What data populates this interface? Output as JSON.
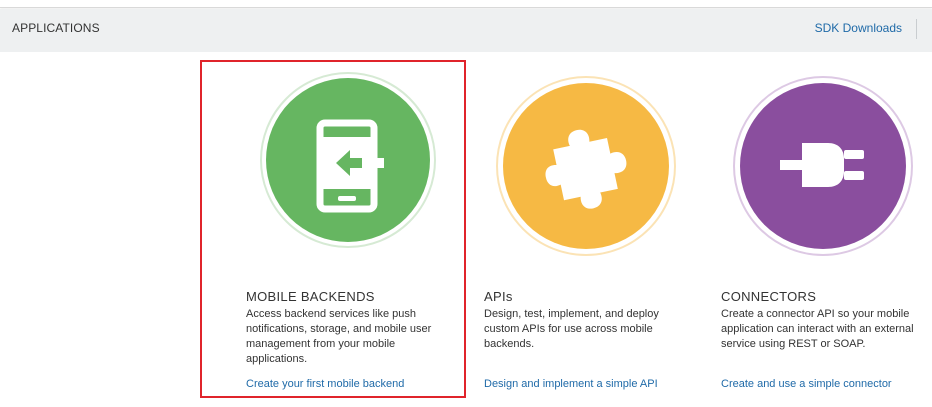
{
  "header": {
    "title": "APPLICATIONS",
    "sdk_link": "SDK Downloads"
  },
  "cards": [
    {
      "title": "MOBILE BACKENDS",
      "description": "Access backend services like push notifications, storage, and mobile user management from your mobile applications.",
      "link": "Create your first mobile backend",
      "icon": "mobile-backend-icon",
      "color": "#66b661",
      "selected": true
    },
    {
      "title": "APIs",
      "description": "Design, test, implement, and deploy custom APIs for use across mobile backends.",
      "link": "Design and implement a simple API",
      "icon": "puzzle-piece-icon",
      "color": "#f6b944"
    },
    {
      "title": "CONNECTORS",
      "description": "Create a connector API so your mobile application can interact with an external service using REST or SOAP.",
      "link": "Create and use a simple connector",
      "icon": "plug-icon",
      "color": "#8a4e9e"
    }
  ],
  "colors": {
    "link": "#1f6aa8",
    "selection_border": "#e0242b",
    "header_bg": "#eef0f1"
  }
}
